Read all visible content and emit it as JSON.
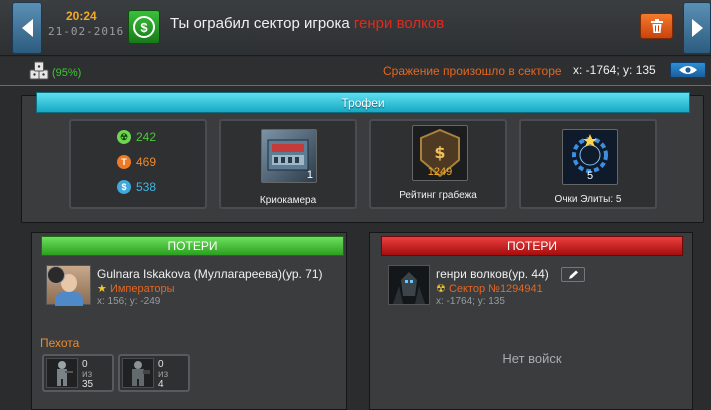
{
  "header": {
    "time": "20:24",
    "date": "21-02-2016",
    "headline_prefix": "Ты ограбил сектор игрока ",
    "enemy_name": "генри волков"
  },
  "subbar": {
    "percent": "(95%)",
    "battle_sector_label": "Сражение произошло в секторе",
    "battle_coords": "x: -1764; y: 135"
  },
  "trophies": {
    "title": "Трофеи",
    "resources": [
      {
        "icon": "uranium-icon",
        "value": "242",
        "color": "#4cc73a"
      },
      {
        "icon": "titanium-icon",
        "value": "469",
        "color": "#f08a2a"
      },
      {
        "icon": "credits-icon",
        "value": "538",
        "color": "#3fb6e8"
      }
    ],
    "items": [
      {
        "label": "Криокамера",
        "badge": "1",
        "icon": "cryochamber-icon"
      },
      {
        "label": "Рейтинг грабежа",
        "badge": "1249",
        "icon": "robbery-rating-icon"
      },
      {
        "label": "Очки Элиты: 5",
        "badge": "5",
        "icon": "elite-points-icon"
      }
    ]
  },
  "attacker": {
    "losses_title": "ПОТЕРИ",
    "name": "Gulnara Iskakova (Муллагареева)(ур. 71)",
    "clan": "Императоры",
    "coords": "x: 156; y: -249",
    "section_title": "Пехота",
    "units": [
      {
        "count": "0",
        "of_label": "из",
        "total": "35",
        "icon": "infantry-unit-icon"
      },
      {
        "count": "0",
        "of_label": "из",
        "total": "4",
        "icon": "heavy-infantry-icon"
      }
    ]
  },
  "defender": {
    "losses_title": "ПОТЕРИ",
    "name": "генри волков(ур. 44)",
    "sector": "Сектор №1294941",
    "coords": "x: -1764; y: 135",
    "no_troops": "Нет войск"
  },
  "colors": {
    "accent_orange": "#e8661f",
    "enemy_red": "#e02a1c",
    "success_green": "#43c43a",
    "banner_cyan": "#16a9c4"
  }
}
